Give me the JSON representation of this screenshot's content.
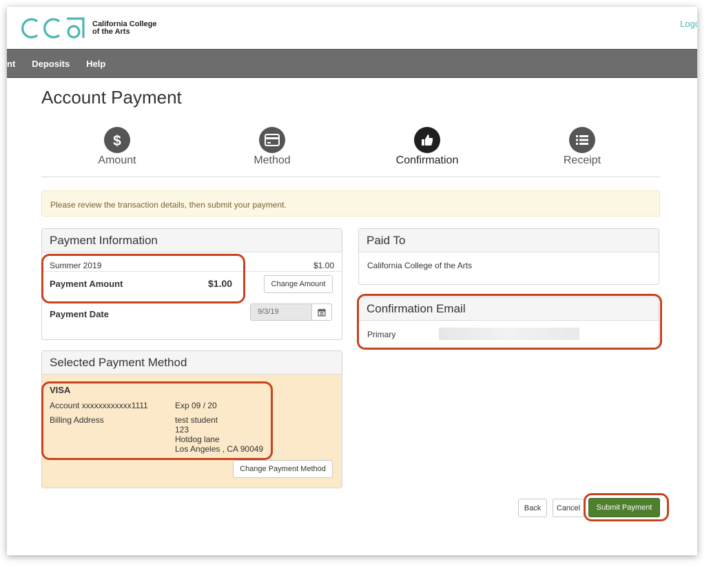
{
  "header": {
    "logo_text_line1": "California College",
    "logo_text_line2": "of the Arts",
    "logout_label": "Logo"
  },
  "nav": {
    "items": [
      "nt",
      "Deposits",
      "Help"
    ]
  },
  "page": {
    "title": "Account Payment"
  },
  "steps": [
    {
      "label": "Amount",
      "icon": "dollar-icon",
      "active": false
    },
    {
      "label": "Method",
      "icon": "card-icon",
      "active": false
    },
    {
      "label": "Confirmation",
      "icon": "thumbs-up-icon",
      "active": true
    },
    {
      "label": "Receipt",
      "icon": "list-icon",
      "active": false
    }
  ],
  "alert": {
    "text": "Please review the transaction details, then submit your payment."
  },
  "payment_info": {
    "title": "Payment Information",
    "term_label": "Summer 2019",
    "term_amount": "$1.00",
    "amount_label": "Payment Amount",
    "amount_value": "$1.00",
    "change_amount_label": "Change Amount",
    "date_label": "Payment Date",
    "date_value": "9/3/19"
  },
  "paid_to": {
    "title": "Paid To",
    "value": "California College of the Arts"
  },
  "confirmation_email": {
    "title": "Confirmation Email",
    "primary_label": "Primary"
  },
  "payment_method": {
    "title": "Selected Payment Method",
    "card_type": "VISA",
    "account": "Account xxxxxxxxxxxx1111",
    "exp": "Exp 09 / 20",
    "billing_label": "Billing Address",
    "billing_name": "test student",
    "billing_line1": "123",
    "billing_line2": "Hotdog lane",
    "billing_city": "Los Angeles , CA 90049",
    "change_label": "Change Payment Method"
  },
  "actions": {
    "back_label": "Back",
    "cancel_label": "Cancel",
    "submit_label": "Submit Payment"
  },
  "colors": {
    "brand_teal": "#4cb6b0",
    "nav_bg": "#6d6d6d",
    "submit_green": "#4e7f2c",
    "highlight_red": "#c8421f",
    "method_bg": "#fbe9c9"
  }
}
